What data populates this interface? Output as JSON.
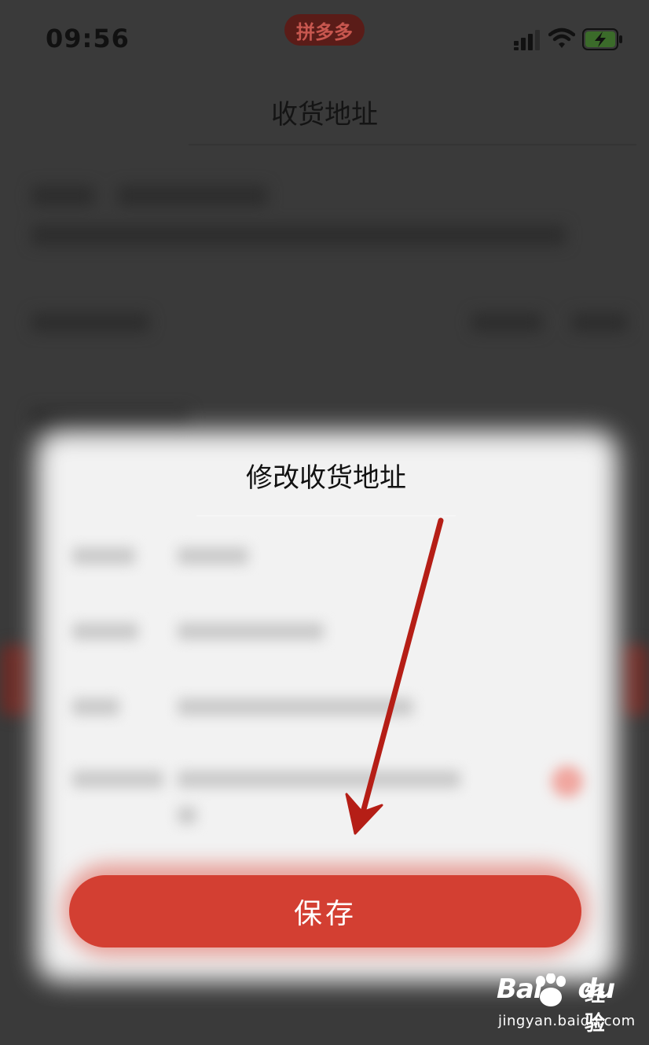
{
  "status_bar": {
    "time": "09:56",
    "app_badge": "拼多多",
    "icons": [
      "signal-icon",
      "wifi-icon",
      "battery-charging-icon"
    ]
  },
  "nav": {
    "title": "收货地址"
  },
  "modal": {
    "title": "修改收货地址",
    "save_label": "保存"
  },
  "annotation": {
    "arrow_color": "#b51e16",
    "points_to": "save-button"
  },
  "watermark": {
    "brand": "Bai",
    "product": "经验",
    "domain": "jingyan.baidu.com"
  },
  "colors": {
    "accent": "#d33f32",
    "overlay": "#3a3a3a",
    "app_badge_bg": "#5a1c18"
  }
}
